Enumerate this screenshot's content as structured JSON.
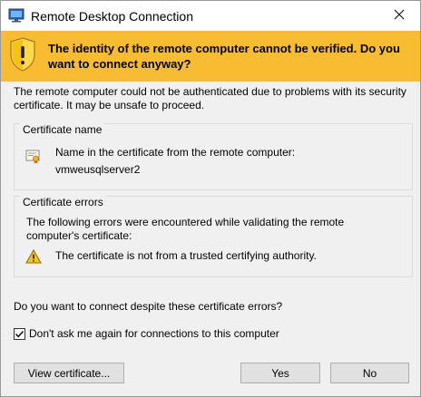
{
  "window": {
    "title": "Remote Desktop Connection",
    "close_symbol": "✕"
  },
  "banner": {
    "message": "The identity of the remote computer cannot be verified. Do you want to connect anyway?",
    "icon": "shield-warning-icon",
    "color": "#f7bc31"
  },
  "intro": "The remote computer could not be authenticated due to problems with its security certificate. It may be unsafe to proceed.",
  "certificate_group": {
    "title": "Certificate name",
    "label": "Name in the certificate from the remote computer:",
    "value": "vmweusqlserver2",
    "icon": "certificate-icon"
  },
  "errors_group": {
    "title": "Certificate errors",
    "intro": "The following errors were encountered while validating the remote computer's certificate:",
    "items": [
      {
        "icon": "warning-icon",
        "text": "The certificate is not from a trusted certifying authority."
      }
    ]
  },
  "question": "Do you want to connect despite these certificate errors?",
  "checkbox": {
    "label": "Don't ask me again for connections to this computer",
    "checked": true
  },
  "buttons": {
    "view_certificate": "View certificate...",
    "yes": "Yes",
    "no": "No"
  }
}
